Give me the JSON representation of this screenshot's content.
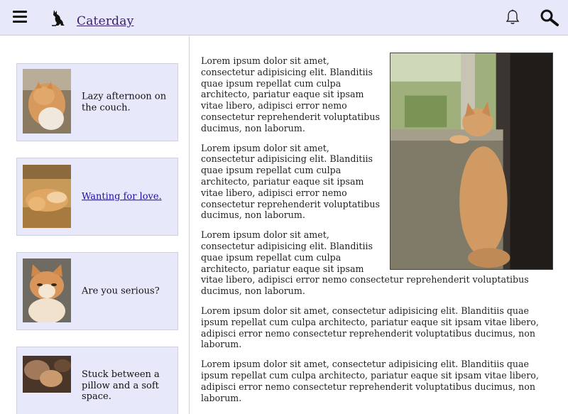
{
  "header": {
    "site_title": "Caterday",
    "menu_icon": "hamburger-menu-icon",
    "logo_icon": "cat-silhouette-logo",
    "notification_icon": "bell-icon",
    "search_icon": "search-icon",
    "background": "#e8e8fb"
  },
  "sidebar": {
    "cards": [
      {
        "caption": "Lazy afternoon on the couch.",
        "is_link": false
      },
      {
        "caption": "Wanting for love.",
        "is_link": true
      },
      {
        "caption": "Are you serious?",
        "is_link": false
      },
      {
        "caption": "Stuck between a pillow and a soft space.",
        "is_link": false
      }
    ]
  },
  "article": {
    "paragraphs": [
      "Lorem ipsum dolor sit amet, consectetur adipisicing elit. Blanditiis quae ipsum repellat cum culpa architecto, pariatur eaque sit ipsam vitae libero, adipisci error nemo consectetur reprehenderit voluptatibus ducimus, non laborum.",
      "Lorem ipsum dolor sit amet, consectetur adipisicing elit. Blanditiis quae ipsum repellat cum culpa architecto, pariatur eaque sit ipsam vitae libero, adipisci error nemo consectetur reprehenderit voluptatibus ducimus, non laborum.",
      "Lorem ipsum dolor sit amet, consectetur adipisicing elit. Blanditiis quae ipsum repellat cum culpa architecto, pariatur eaque sit ipsam vitae libero, adipisci error nemo consectetur reprehenderit voluptatibus ducimus, non laborum.",
      "Lorem ipsum dolor sit amet, consectetur adipisicing elit. Blanditiis quae ipsum repellat cum culpa architecto, pariatur eaque sit ipsam vitae libero, adipisci error nemo consectetur reprehenderit voluptatibus ducimus, non laborum.",
      "Lorem ipsum dolor sit amet, consectetur adipisicing elit. Blanditiis quae ipsum repellat cum culpa architecto, pariatur eaque sit ipsam vitae libero, adipisci error nemo consectetur reprehenderit voluptatibus ducimus, non laborum."
    ]
  }
}
